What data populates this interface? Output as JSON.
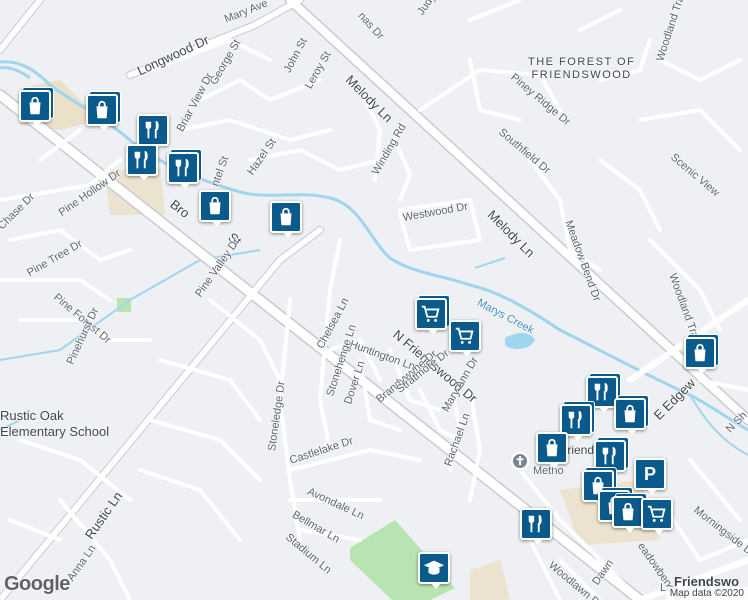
{
  "map": {
    "colors": {
      "background": "#eef0f3",
      "road": "#ffffff",
      "road_outline": "#c7cbd1",
      "water": "#9fd6ee",
      "park": "#b7e4b0",
      "pin": "#0b5a8c"
    },
    "area_labels": {
      "forest": "THE FOREST OF\nFRIENDSWOOD"
    },
    "school_label": "Rustic Oak\nElementary School",
    "streets": {
      "mary_ave": "Mary Ave",
      "longwood_dr": "Longwood Dr",
      "george_st": "George St",
      "john_st": "John St",
      "leroy_st": "Leroy St",
      "melody_ln_1": "Melody Ln",
      "melody_ln_2": "Melody Ln",
      "judy": "Judy",
      "thomas_dr": "nas Dr",
      "briar_view_dr": "Briar View Dr",
      "hazel_st": "Hazel St",
      "chantel_st": "ntel St",
      "winding_rd": "Winding Rd",
      "piney_ridge_dr": "Piney Ridge Dr",
      "southfield_dr": "Southfield Dr",
      "woodland_trail_top": "Woodland Trai",
      "scenic_view": "Scenic View",
      "chase_dr": "Chase Dr",
      "pine_hollow_dr": "Pine Hollow Dr",
      "brook_st": "Bro",
      "brook_st_2": "St",
      "westwood_dr": "Westwood Dr",
      "meadow_bend_dr": "Meadow Bend Dr",
      "pine_tree_dr": "Pine Tree Dr",
      "pine_valley_dr": "Pine Valley Dr",
      "woodland_trail_dr": "Woodland Trail Dr",
      "pine_forest_dr": "Pine Forest Dr",
      "marys_creek": "Marys Creek",
      "chelsea_ln": "Chelsea Ln",
      "n_friendswood_dr": "N Friendswood Dr",
      "e_edgewood": "E Edgew",
      "pinehurst_dr": "Pinehurst Dr",
      "huntington_ln": "Huntington Ln",
      "stonehenge_ln": "Stonehenge Ln",
      "dover_ln": "Dover Ln",
      "brandywyne_dr": "Brandywyne Dr",
      "stratmore_dr": "Stratmore Dr",
      "mary_ann_dr": "Mary Ann Dr",
      "stoneledge_dr": "Stoneledge Dr",
      "n_sh": "N Sh",
      "castlelake_dr": "Castlelake Dr",
      "rachael_ln": "Rachael Ln",
      "avondale_ln": "Avondale Ln",
      "morningside_dr": "Morningside Dr",
      "bellmar_ln": "Bellmar Ln",
      "rustic_ln": "Rustic Ln",
      "stadium_ln": "Stadium Ln",
      "anna_ln": "Anna Ln",
      "woodlawn_dr": "Woodlawn Dr",
      "dawn": "Dawn",
      "meadowbend_ave": "eadowbend Ave",
      "friendswood": "Friendswo",
      "la": "La",
      "friendsv": "Friendsv",
      "methodist": "Metho"
    },
    "pins": [
      {
        "icon": "shopping-bag"
      },
      {
        "icon": "shopping-bag"
      },
      {
        "icon": "restaurant"
      },
      {
        "icon": "restaurant"
      },
      {
        "icon": "restaurant"
      },
      {
        "icon": "shopping-bag"
      },
      {
        "icon": "shopping-bag"
      },
      {
        "icon": "grocery-cart"
      },
      {
        "icon": "grocery-cart"
      },
      {
        "icon": "shopping-bag"
      },
      {
        "icon": "restaurant"
      },
      {
        "icon": "restaurant"
      },
      {
        "icon": "shopping-bag"
      },
      {
        "icon": "restaurant"
      },
      {
        "icon": "shopping-bag"
      },
      {
        "icon": "restaurant"
      },
      {
        "icon": "parking"
      },
      {
        "icon": "shopping-bag"
      },
      {
        "icon": "shopping-bag"
      },
      {
        "icon": "grocery-cart"
      },
      {
        "icon": "restaurant"
      },
      {
        "icon": "school"
      }
    ],
    "logo": "Google",
    "attribution": "Map data ©2020"
  }
}
